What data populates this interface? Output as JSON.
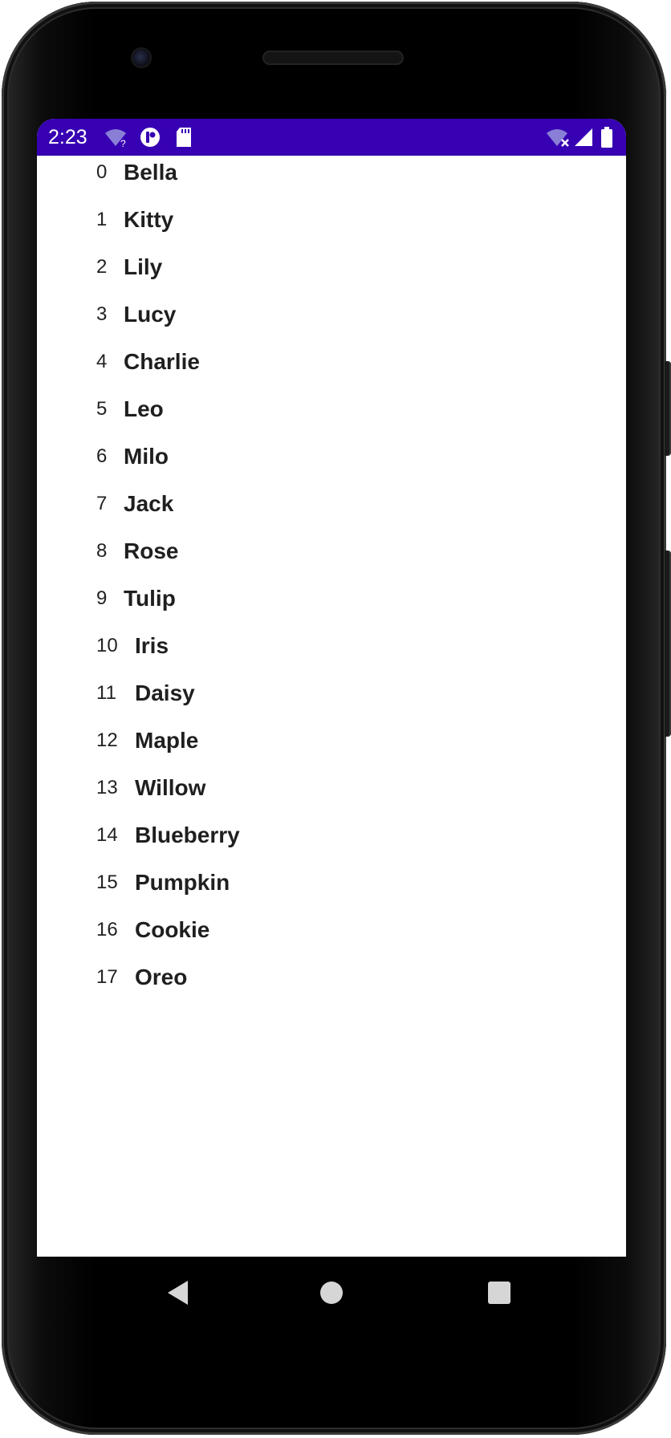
{
  "status_bar": {
    "time": "2:23",
    "background": "#3700b3",
    "icons_left": [
      "wifi-unknown-icon",
      "app-notification-icon",
      "sd-card-icon"
    ],
    "icons_right": [
      "wifi-off-icon",
      "cell-signal-icon",
      "battery-icon"
    ]
  },
  "list": {
    "items": [
      {
        "index": "0",
        "name": "Bella"
      },
      {
        "index": "1",
        "name": "Kitty"
      },
      {
        "index": "2",
        "name": "Lily"
      },
      {
        "index": "3",
        "name": "Lucy"
      },
      {
        "index": "4",
        "name": "Charlie"
      },
      {
        "index": "5",
        "name": "Leo"
      },
      {
        "index": "6",
        "name": "Milo"
      },
      {
        "index": "7",
        "name": "Jack"
      },
      {
        "index": "8",
        "name": "Rose"
      },
      {
        "index": "9",
        "name": "Tulip"
      },
      {
        "index": "10",
        "name": "Iris"
      },
      {
        "index": "11",
        "name": "Daisy"
      },
      {
        "index": "12",
        "name": "Maple"
      },
      {
        "index": "13",
        "name": "Willow"
      },
      {
        "index": "14",
        "name": "Blueberry"
      },
      {
        "index": "15",
        "name": "Pumpkin"
      },
      {
        "index": "16",
        "name": "Cookie"
      },
      {
        "index": "17",
        "name": "Oreo"
      }
    ]
  },
  "nav_bar": {
    "buttons": [
      "back-icon",
      "home-icon",
      "recents-icon"
    ],
    "icon_color": "#d6d6d6"
  }
}
